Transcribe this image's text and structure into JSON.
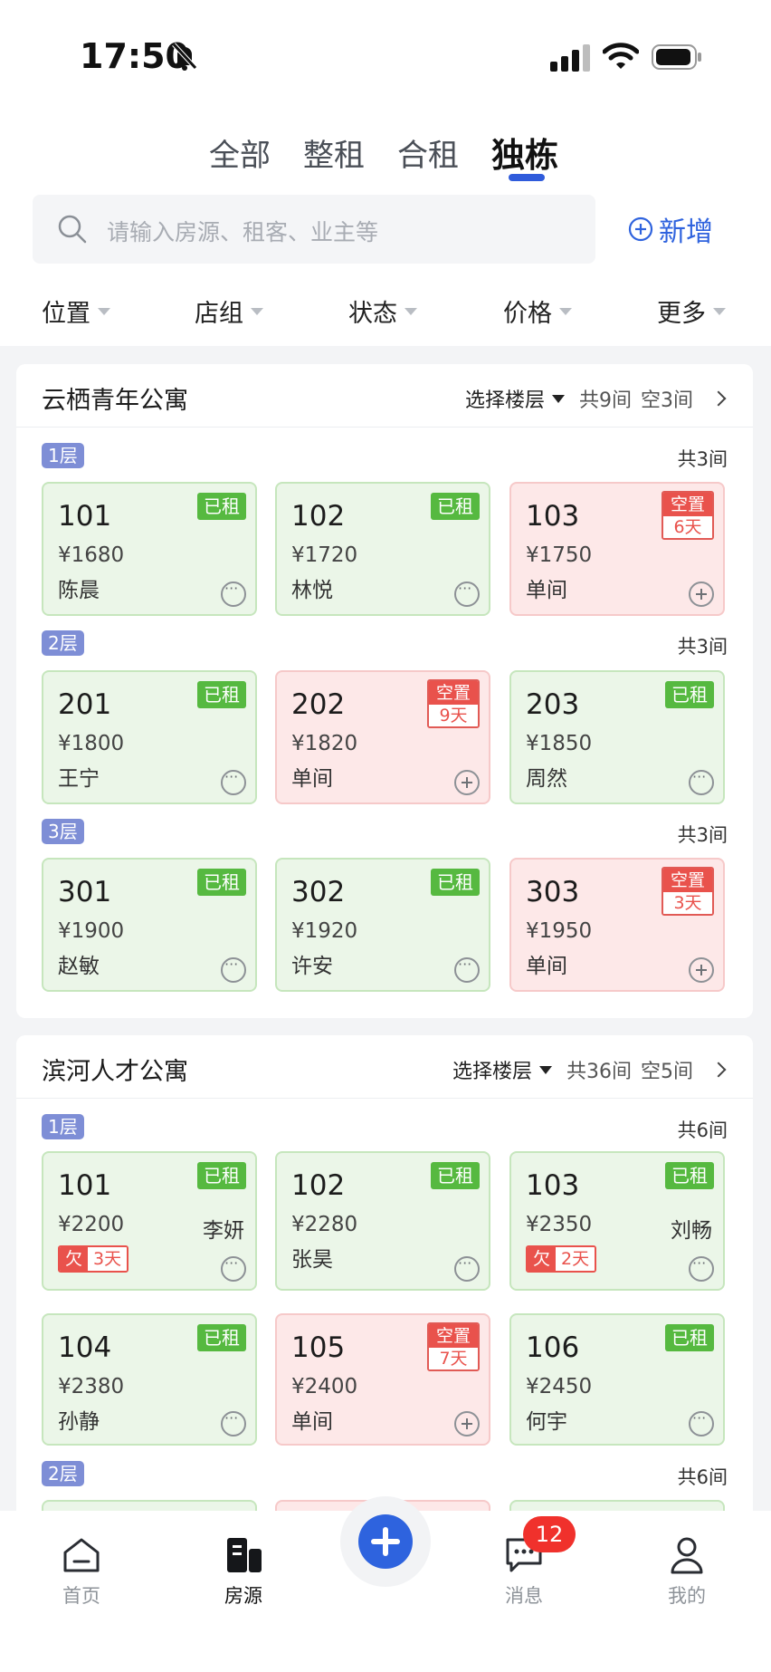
{
  "status": {
    "time": "17:50"
  },
  "tabs": [
    "全部",
    "整租",
    "合租",
    "独栋"
  ],
  "active_tab": "独栋",
  "search": {
    "placeholder": "请输入房源、租客、业主等"
  },
  "add_label": "新增",
  "filters": [
    "位置",
    "店组",
    "状态",
    "价格",
    "更多"
  ],
  "buildings": [
    {
      "name": "云栖青年公寓",
      "select_floor": "选择楼层",
      "total": "共9间",
      "empty": "空3间",
      "floors": [
        {
          "label": "1层",
          "count": "共3间",
          "rooms": [
            {
              "num": "101",
              "price": "¥1680",
              "name": "陈晨",
              "status": "已租"
            },
            {
              "num": "102",
              "price": "¥1720",
              "name": "林悦",
              "status": "已租"
            },
            {
              "num": "103",
              "price": "¥1750",
              "name": "单间",
              "status": "空置",
              "days": "6天"
            }
          ]
        },
        {
          "label": "2层",
          "count": "共3间",
          "rooms": [
            {
              "num": "201",
              "price": "¥1800",
              "name": "王宁",
              "status": "已租"
            },
            {
              "num": "202",
              "price": "¥1820",
              "name": "单间",
              "status": "空置",
              "days": "9天"
            },
            {
              "num": "203",
              "price": "¥1850",
              "name": "周然",
              "status": "已租"
            }
          ]
        },
        {
          "label": "3层",
          "count": "共3间",
          "rooms": [
            {
              "num": "301",
              "price": "¥1900",
              "name": "赵敏",
              "status": "已租"
            },
            {
              "num": "302",
              "price": "¥1920",
              "name": "许安",
              "status": "已租"
            },
            {
              "num": "303",
              "price": "¥1950",
              "name": "单间",
              "status": "空置",
              "days": "3天"
            }
          ]
        }
      ]
    },
    {
      "name": "滨河人才公寓",
      "select_floor": "选择楼层",
      "total": "共36间",
      "empty": "空5间",
      "floors": [
        {
          "label": "1层",
          "count": "共6间",
          "rooms": [
            {
              "num": "101",
              "price": "¥2200",
              "name": "李妍",
              "status": "已租",
              "owe": "欠",
              "owe_days": "3天"
            },
            {
              "num": "102",
              "price": "¥2280",
              "name": "张昊",
              "status": "已租"
            },
            {
              "num": "103",
              "price": "¥2350",
              "name": "刘畅",
              "status": "已租",
              "owe": "欠",
              "owe_days": "2天"
            },
            {
              "num": "104",
              "price": "¥2380",
              "name": "孙静",
              "status": "已租"
            },
            {
              "num": "105",
              "price": "¥2400",
              "name": "单间",
              "status": "空置",
              "days": "7天"
            },
            {
              "num": "106",
              "price": "¥2450",
              "name": "何宇",
              "status": "已租"
            }
          ]
        },
        {
          "label": "2层",
          "count": "共6间",
          "rooms": []
        }
      ]
    }
  ],
  "nav": [
    {
      "label": "首页",
      "icon": "home-icon"
    },
    {
      "label": "房源",
      "icon": "building-icon"
    },
    {
      "label": "消息",
      "icon": "message-icon",
      "badge": "12"
    },
    {
      "label": "我的",
      "icon": "user-icon"
    }
  ],
  "colors": {
    "accent": "#2f63de",
    "rented_tag": "#56b940",
    "vacant_tag": "#e9524c",
    "floor_badge": "#7e8ed6"
  }
}
